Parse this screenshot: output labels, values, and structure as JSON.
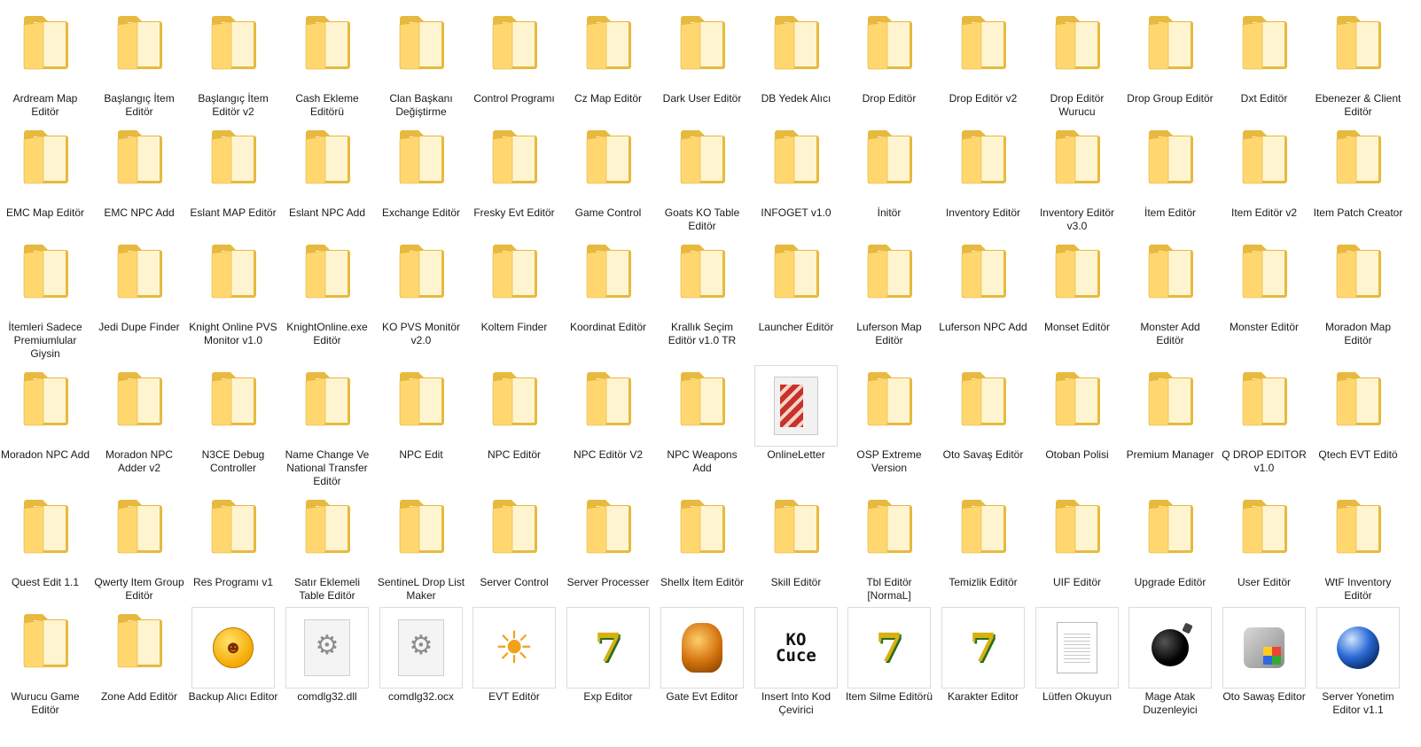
{
  "colors": {
    "folder_back": "#E7B93F",
    "folder_front": "#FFD76E",
    "folder_paper": "#FFF4D0",
    "background": "#FFFFFF"
  },
  "items": [
    {
      "label": "Ardream Map Editör",
      "icon": "folder-icon"
    },
    {
      "label": "Başlangıç İtem Editör",
      "icon": "folder-icon"
    },
    {
      "label": "Başlangıç İtem Editör v2",
      "icon": "folder-icon"
    },
    {
      "label": "Cash Ekleme Editörü",
      "icon": "folder-icon"
    },
    {
      "label": "Clan Başkanı Değiştirme",
      "icon": "folder-icon"
    },
    {
      "label": "Control Programı",
      "icon": "folder-icon"
    },
    {
      "label": "Cz Map Editör",
      "icon": "folder-icon"
    },
    {
      "label": "Dark User Editör",
      "icon": "folder-icon"
    },
    {
      "label": "DB Yedek Alıcı",
      "icon": "folder-icon"
    },
    {
      "label": "Drop Editör",
      "icon": "folder-icon"
    },
    {
      "label": "Drop Editör v2",
      "icon": "folder-icon"
    },
    {
      "label": "Drop Editör Wurucu",
      "icon": "folder-icon"
    },
    {
      "label": "Drop Group Editör",
      "icon": "folder-icon"
    },
    {
      "label": "Dxt Editör",
      "icon": "folder-icon"
    },
    {
      "label": "Ebenezer & Client Editör",
      "icon": "folder-icon"
    },
    {
      "label": "EMC Map Editör",
      "icon": "folder-icon"
    },
    {
      "label": "EMC NPC Add",
      "icon": "folder-icon"
    },
    {
      "label": "Eslant MAP Editör",
      "icon": "folder-icon"
    },
    {
      "label": "Eslant NPC Add",
      "icon": "folder-icon"
    },
    {
      "label": "Exchange Editör",
      "icon": "folder-icon"
    },
    {
      "label": "Fresky Evt Editör",
      "icon": "folder-icon"
    },
    {
      "label": "Game Control",
      "icon": "folder-icon"
    },
    {
      "label": "Goats KO Table Editör",
      "icon": "folder-icon"
    },
    {
      "label": "INFOGET v1.0",
      "icon": "folder-icon"
    },
    {
      "label": "İnitör",
      "icon": "folder-icon"
    },
    {
      "label": "Inventory Editör",
      "icon": "folder-icon"
    },
    {
      "label": "Inventory Editör v3.0",
      "icon": "folder-icon"
    },
    {
      "label": "İtem Editör",
      "icon": "folder-icon"
    },
    {
      "label": "Item Editör v2",
      "icon": "folder-icon"
    },
    {
      "label": "Item Patch Creator",
      "icon": "folder-icon"
    },
    {
      "label": "İtemleri Sadece Premiumlular Giysin",
      "icon": "folder-icon"
    },
    {
      "label": "Jedi Dupe Finder",
      "icon": "folder-icon"
    },
    {
      "label": "Knight Online PVS Monitor v1.0",
      "icon": "folder-icon"
    },
    {
      "label": "KnightOnline.exe Editör",
      "icon": "folder-icon"
    },
    {
      "label": "KO PVS Monitör v2.0",
      "icon": "folder-icon"
    },
    {
      "label": "Koltem Finder",
      "icon": "folder-icon"
    },
    {
      "label": "Koordinat Editör",
      "icon": "folder-icon"
    },
    {
      "label": "Krallık Seçim Editör v1.0 TR",
      "icon": "folder-icon"
    },
    {
      "label": "Launcher Editör",
      "icon": "folder-icon"
    },
    {
      "label": "Luferson Map Editör",
      "icon": "folder-icon"
    },
    {
      "label": "Luferson NPC Add",
      "icon": "folder-icon"
    },
    {
      "label": "Monset Editör",
      "icon": "folder-icon"
    },
    {
      "label": "Monster Add Editör",
      "icon": "folder-icon"
    },
    {
      "label": "Monster Editör",
      "icon": "folder-icon"
    },
    {
      "label": "Moradon Map Editör",
      "icon": "folder-icon"
    },
    {
      "label": "Moradon NPC Add",
      "icon": "folder-icon"
    },
    {
      "label": "Moradon NPC Adder v2",
      "icon": "folder-icon"
    },
    {
      "label": "N3CE Debug Controller",
      "icon": "folder-icon"
    },
    {
      "label": "Name Change Ve National Transfer Editör",
      "icon": "folder-icon"
    },
    {
      "label": "NPC Edit",
      "icon": "folder-icon"
    },
    {
      "label": "NPC Editör",
      "icon": "folder-icon"
    },
    {
      "label": "NPC Editör V2",
      "icon": "folder-icon"
    },
    {
      "label": "NPC Weapons Add",
      "icon": "folder-icon"
    },
    {
      "label": "OnlineLetter",
      "icon": "letter-folder-icon"
    },
    {
      "label": "OSP Extreme Version",
      "icon": "folder-icon"
    },
    {
      "label": "Oto Savaş Editör",
      "icon": "folder-icon"
    },
    {
      "label": "Otoban Polisi",
      "icon": "folder-icon"
    },
    {
      "label": "Premium Manager",
      "icon": "folder-icon"
    },
    {
      "label": "Q DROP EDITOR v1.0",
      "icon": "folder-icon"
    },
    {
      "label": "Qtech EVT Editö",
      "icon": "folder-icon"
    },
    {
      "label": "Quest Edit 1.1",
      "icon": "folder-icon"
    },
    {
      "label": "Qwerty Item Group Editör",
      "icon": "folder-icon"
    },
    {
      "label": "Res Programı v1",
      "icon": "folder-icon"
    },
    {
      "label": "Satır Eklemeli Table Editör",
      "icon": "folder-icon"
    },
    {
      "label": "SentineL Drop List Maker",
      "icon": "folder-icon"
    },
    {
      "label": "Server Control",
      "icon": "folder-icon"
    },
    {
      "label": "Server Processer",
      "icon": "folder-icon"
    },
    {
      "label": "Shellx İtem Editör",
      "icon": "folder-icon"
    },
    {
      "label": "Skill Editör",
      "icon": "folder-icon"
    },
    {
      "label": "Tbl Editör [NormaL]",
      "icon": "folder-icon"
    },
    {
      "label": "Temizlik Editör",
      "icon": "folder-icon"
    },
    {
      "label": "UIF Editör",
      "icon": "folder-icon"
    },
    {
      "label": "Upgrade Editör",
      "icon": "folder-icon"
    },
    {
      "label": "User Editör",
      "icon": "folder-icon"
    },
    {
      "label": "WtF Inventory Editör",
      "icon": "folder-icon"
    },
    {
      "label": "Wurucu Game Editör",
      "icon": "folder-icon"
    },
    {
      "label": "Zone Add Editör",
      "icon": "folder-icon"
    },
    {
      "label": "Backup Alıcı Editor",
      "icon": "smiley-icon"
    },
    {
      "label": "comdlg32.dll",
      "icon": "gear-file-icon"
    },
    {
      "label": "comdlg32.ocx",
      "icon": "gear-file-icon"
    },
    {
      "label": "EVT Editör",
      "icon": "sun-icon"
    },
    {
      "label": "Exp Editor",
      "icon": "seven-icon"
    },
    {
      "label": "Gate Evt Editor",
      "icon": "samovar-icon"
    },
    {
      "label": "Insert Into Kod Çevirici",
      "icon": "ko-cuce-icon"
    },
    {
      "label": "Item Silme Editörü",
      "icon": "seven-icon"
    },
    {
      "label": "Karakter Editor",
      "icon": "seven-icon"
    },
    {
      "label": "Lütfen Okuyun",
      "icon": "text-document-icon"
    },
    {
      "label": "Mage Atak Duzenleyici",
      "icon": "bomb-icon"
    },
    {
      "label": "Oto Sawaş Editor",
      "icon": "window-app-icon"
    },
    {
      "label": "Server Yonetim Editor v1.1",
      "icon": "blue-orb-icon"
    }
  ],
  "ko_cuce_text": [
    "KO",
    "Cuce"
  ]
}
